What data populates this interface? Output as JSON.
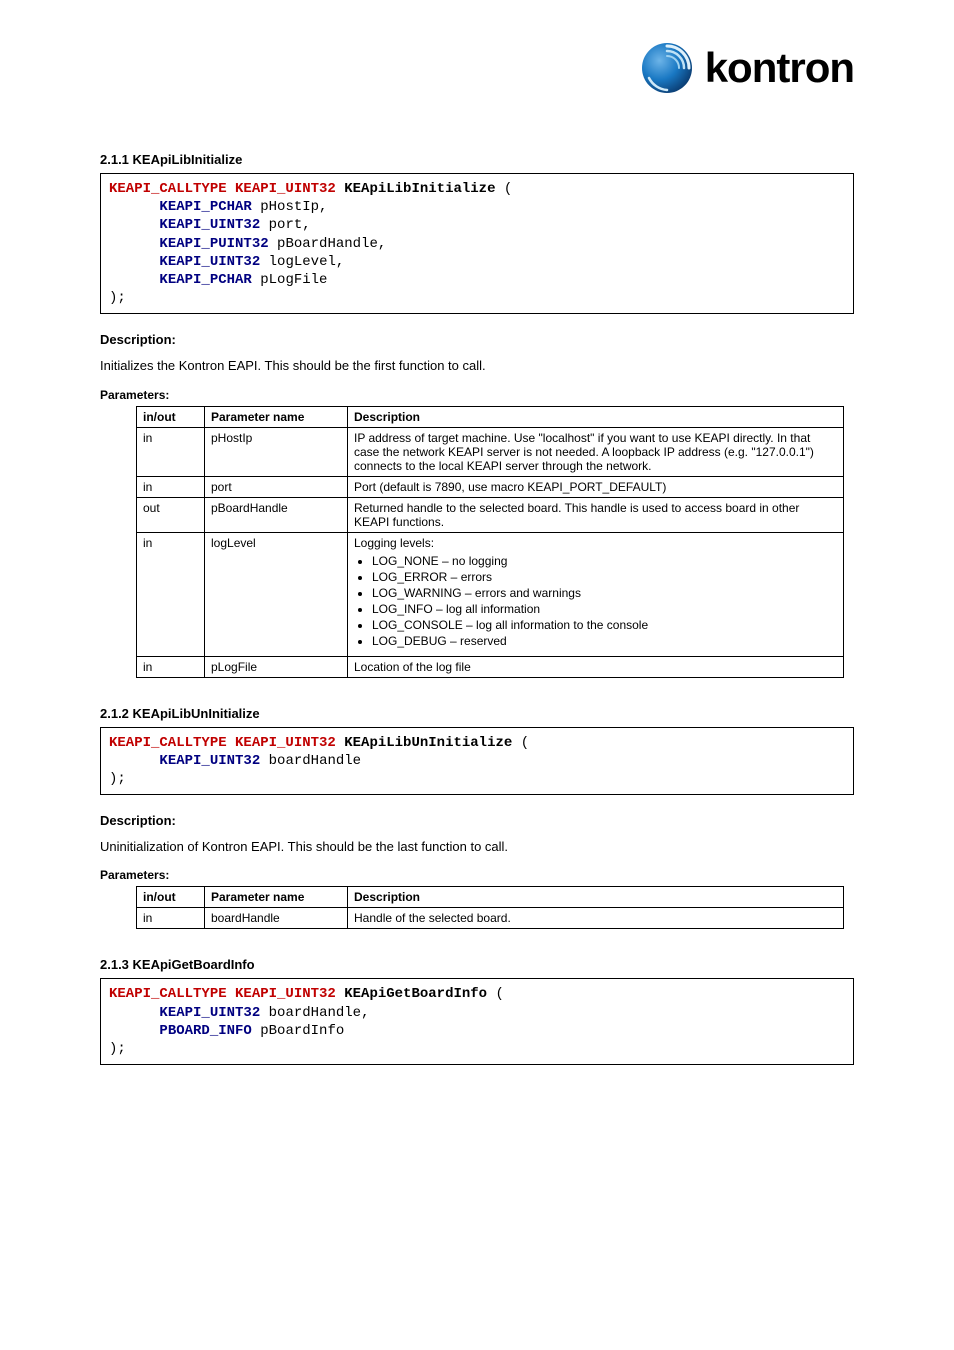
{
  "brand": "kontron",
  "sections": {
    "init": {
      "heading": "2.1.1   KEApiLibInitialize",
      "code": {
        "ret": "KEAPI_CALLTYPE KEAPI_UINT32",
        "fn": "KEApiLibInitialize",
        "params": [
          {
            "type": "KEAPI_PCHAR",
            "name": "pHostIp,"
          },
          {
            "type": "KEAPI_UINT32",
            "name": "port,"
          },
          {
            "type": "KEAPI_PUINT32",
            "name": "pBoardHandle,"
          },
          {
            "type": "KEAPI_UINT32",
            "name": "logLevel,"
          },
          {
            "type": "KEAPI_PCHAR",
            "name": "pLogFile"
          }
        ]
      },
      "description": "Initializes the Kontron EAPI. This should be the first function to call.",
      "params_label": "Parameters:",
      "table": {
        "headers": [
          "in/out",
          "Parameter name",
          "Description"
        ],
        "rows": [
          {
            "io": "in",
            "name": "pHostIp",
            "desc_pre": "IP address of target machine. Use ",
            "literal1": "\"localhost\"",
            "desc_mid": " if you want to use KEAPI directly. In that case the network KEAPI server is not needed. A loopback IP address (e.g. ",
            "literal2": "\"127.0.0.1\"",
            "desc_post": ") connects to the local KEAPI server through the network."
          },
          {
            "io": "in",
            "name": "port",
            "desc": "Port (default is 7890, use macro KEAPI_PORT_DEFAULT)"
          },
          {
            "io": "out",
            "name": "pBoardHandle",
            "desc": "Returned handle to the selected board. This handle is used to access board in other KEAPI functions."
          },
          {
            "io": "in",
            "name": "logLevel",
            "desc_pre": "Logging levels:",
            "levels": [
              "LOG_NONE – no logging",
              "LOG_ERROR – errors",
              "LOG_WARNING – errors and warnings",
              "LOG_INFO – log all information",
              "LOG_CONSOLE – log all information to the console",
              "LOG_DEBUG – reserved"
            ]
          },
          {
            "io": "in",
            "name": "pLogFile",
            "desc": "Location of the log file"
          }
        ]
      }
    },
    "uninit": {
      "heading": "2.1.2   KEApiLibUnInitialize",
      "code": {
        "ret": "KEAPI_CALLTYPE KEAPI_UINT32",
        "fn": "KEApiLibUnInitialize",
        "params": [
          {
            "type": "KEAPI_UINT32",
            "name": "boardHandle"
          }
        ]
      },
      "description": "Uninitialization of Kontron EAPI. This should be the last function to call.",
      "params_label": "Parameters:",
      "table": {
        "headers": [
          "in/out",
          "Parameter name",
          "Description"
        ],
        "rows": [
          {
            "io": "in",
            "name": "boardHandle",
            "desc": "Handle of the selected board."
          }
        ]
      }
    },
    "boardinfo": {
      "heading": "2.1.3   KEApiGetBoardInfo",
      "code": {
        "ret": "KEAPI_CALLTYPE KEAPI_UINT32",
        "fn": "KEApiGetBoardInfo",
        "params": [
          {
            "type": "KEAPI_UINT32",
            "name": "boardHandle,"
          },
          {
            "type": "PBOARD_INFO",
            "name": "pBoardInfo"
          }
        ]
      }
    }
  }
}
